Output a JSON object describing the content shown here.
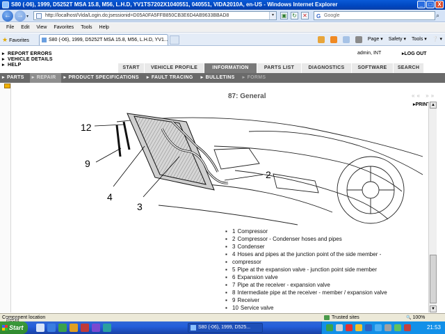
{
  "window": {
    "title": "S80 (-06), 1999, D5252T MSA 15.8, M56, L.H.D, YV1TS7202X1040551, 040551, VIDA2010A, en-US - Windows Internet Explorer",
    "minimize": "_",
    "maximize": "□",
    "close": "X"
  },
  "browser": {
    "url": "http://localhost/Vida/Login.do;jsessionid=D05A0FA5FFB850CB3E6D4AB9633BBAD8",
    "search_placeholder": "Google",
    "menu": [
      "File",
      "Edit",
      "View",
      "Favorites",
      "Tools",
      "Help"
    ],
    "favorites_label": "Favorites",
    "tab_title": "S80 (-06), 1999, D5252T MSA 15.8, M56, L.H.D, YV1...",
    "cmd": [
      "Page ▾",
      "Safety ▾",
      "Tools ▾",
      "❔ ▾"
    ],
    "status_text": "Component location",
    "status_trusted": "Trusted sites",
    "zoom": "100%"
  },
  "vida": {
    "left_links": [
      "REPORT ERRORS",
      "VEHICLE DETAILS",
      "HELP"
    ],
    "user": "admin, INT",
    "logout": "LOG OUT",
    "main_tabs": [
      "START",
      "VEHICLE PROFILE",
      "INFORMATION",
      "PARTS LIST",
      "DIAGNOSTICS",
      "SOFTWARE",
      "SEARCH"
    ],
    "sub_tabs": [
      "PARTS",
      "REPAIR",
      "PRODUCT SPECIFICATIONS",
      "FAULT TRACING",
      "BULLETINS",
      "FORMS"
    ],
    "doc_title": "87: General",
    "prev_next": "«« »»",
    "print": "PRINT",
    "callouts": [
      "12",
      "9",
      "4",
      "3",
      "2"
    ],
    "legend": [
      {
        "num": "1",
        "text": "Compressor"
      },
      {
        "num": "2",
        "text": "Compressor - Condenser hoses and pipes"
      },
      {
        "num": "3",
        "text": "Condenser"
      },
      {
        "num": "4",
        "text": "Hoses and pipes at the junction point of the side member -"
      },
      {
        "num": "",
        "text": "compressor"
      },
      {
        "num": "5",
        "text": "Pipe at the expansion valve - junction point side member"
      },
      {
        "num": "6",
        "text": "Expansion valve"
      },
      {
        "num": "7",
        "text": "Pipe at the receiver - expansion valve"
      },
      {
        "num": "8",
        "text": "Intermediate pipe at the receiver - member / expansion valve"
      },
      {
        "num": "9",
        "text": "Receiver"
      },
      {
        "num": "10",
        "text": "Service valve"
      }
    ]
  },
  "taskbar": {
    "start": "Start",
    "task_item": "S80 (-06), 1999, D525...",
    "clock": "21:53",
    "desktop_label": "Recht"
  }
}
